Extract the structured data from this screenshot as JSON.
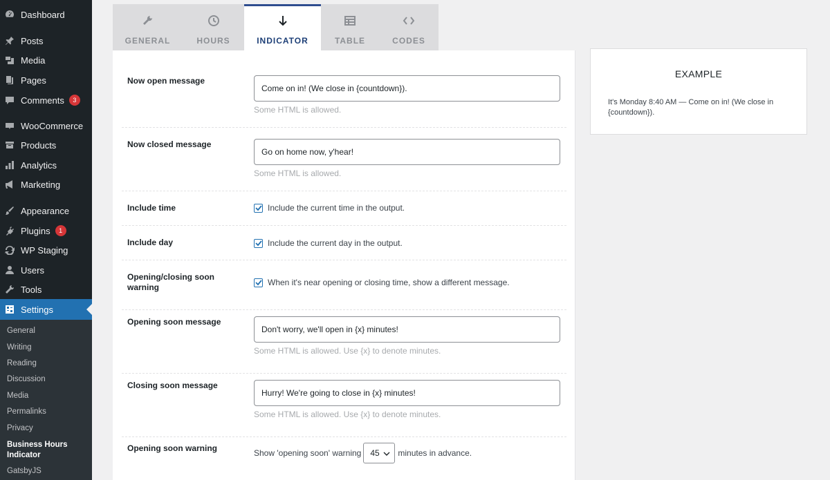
{
  "sidebar": {
    "items": [
      {
        "label": "Dashboard",
        "icon": "dashboard-icon"
      },
      {
        "label": "Posts",
        "icon": "pin-icon"
      },
      {
        "label": "Media",
        "icon": "media-icon"
      },
      {
        "label": "Pages",
        "icon": "pages-icon"
      },
      {
        "label": "Comments",
        "icon": "comment-icon",
        "badge": "3"
      },
      {
        "label": "WooCommerce",
        "icon": "woo-icon"
      },
      {
        "label": "Products",
        "icon": "archive-icon"
      },
      {
        "label": "Analytics",
        "icon": "chart-bar-icon"
      },
      {
        "label": "Marketing",
        "icon": "megaphone-icon"
      },
      {
        "label": "Appearance",
        "icon": "brush-icon"
      },
      {
        "label": "Plugins",
        "icon": "plugin-icon",
        "badge": "1"
      },
      {
        "label": "WP Staging",
        "icon": "refresh-icon"
      },
      {
        "label": "Users",
        "icon": "user-icon"
      },
      {
        "label": "Tools",
        "icon": "wrench-icon"
      },
      {
        "label": "Settings",
        "icon": "settings-icon"
      }
    ],
    "submenu": [
      "General",
      "Writing",
      "Reading",
      "Discussion",
      "Media",
      "Permalinks",
      "Privacy",
      "Business Hours Indicator",
      "GatsbyJS"
    ]
  },
  "tabs": [
    {
      "label": "GENERAL",
      "icon": "wrench-icon"
    },
    {
      "label": "HOURS",
      "icon": "clock-icon"
    },
    {
      "label": "INDICATOR",
      "icon": "arrow-down-icon"
    },
    {
      "label": "TABLE",
      "icon": "table-icon"
    },
    {
      "label": "CODES",
      "icon": "code-icon"
    }
  ],
  "active_tab": "INDICATOR",
  "form": {
    "now_open": {
      "label": "Now open message",
      "value": "Come on in! (We close in {countdown}).",
      "hint": "Some HTML is allowed."
    },
    "now_closed": {
      "label": "Now closed message",
      "value": "Go on home now, y'hear!",
      "hint": "Some HTML is allowed."
    },
    "include_time": {
      "label": "Include time",
      "checkbox_label": "Include the current time in the output.",
      "checked": true
    },
    "include_day": {
      "label": "Include day",
      "checkbox_label": "Include the current day in the output.",
      "checked": true
    },
    "soon_warning": {
      "label": "Opening/closing soon warning",
      "checkbox_label": "When it's near opening or closing time, show a different message.",
      "checked": true
    },
    "opening_soon": {
      "label": "Opening soon message",
      "value": "Don't worry, we'll open in {x} minutes!",
      "hint": "Some HTML is allowed. Use {x} to denote minutes."
    },
    "closing_soon": {
      "label": "Closing soon message",
      "value": "Hurry! We're going to close in {x} minutes!",
      "hint": "Some HTML is allowed. Use {x} to denote minutes."
    },
    "opening_warning": {
      "label": "Opening soon warning",
      "prefix": "Show 'opening soon' warning",
      "value": "45",
      "suffix": "minutes in advance."
    }
  },
  "example": {
    "title": "EXAMPLE",
    "text": "It's Monday 8:40 AM — Come on in! (We close in {countdown})."
  },
  "colors": {
    "sidebar": "#1d2327",
    "accent": "#2271b1",
    "badge": "#d63638"
  }
}
